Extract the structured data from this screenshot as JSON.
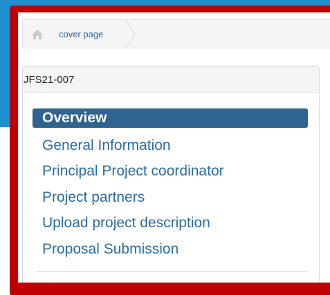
{
  "breadcrumb": {
    "home_icon": "home-icon",
    "label": "cover page"
  },
  "sidebar": {
    "title": "JFS21-007",
    "items": [
      {
        "label": "Overview",
        "active": true
      },
      {
        "label": "General Information",
        "active": false
      },
      {
        "label": "Principal Project coordinator",
        "active": false
      },
      {
        "label": "Project partners",
        "active": false
      },
      {
        "label": "Upload project description",
        "active": false
      },
      {
        "label": "Proposal Submission",
        "active": false
      }
    ]
  },
  "colors": {
    "highlight_frame": "#c00000",
    "background_blue": "#1f8fd0",
    "link": "#2b6ca3",
    "active_item": "#2f6491"
  }
}
